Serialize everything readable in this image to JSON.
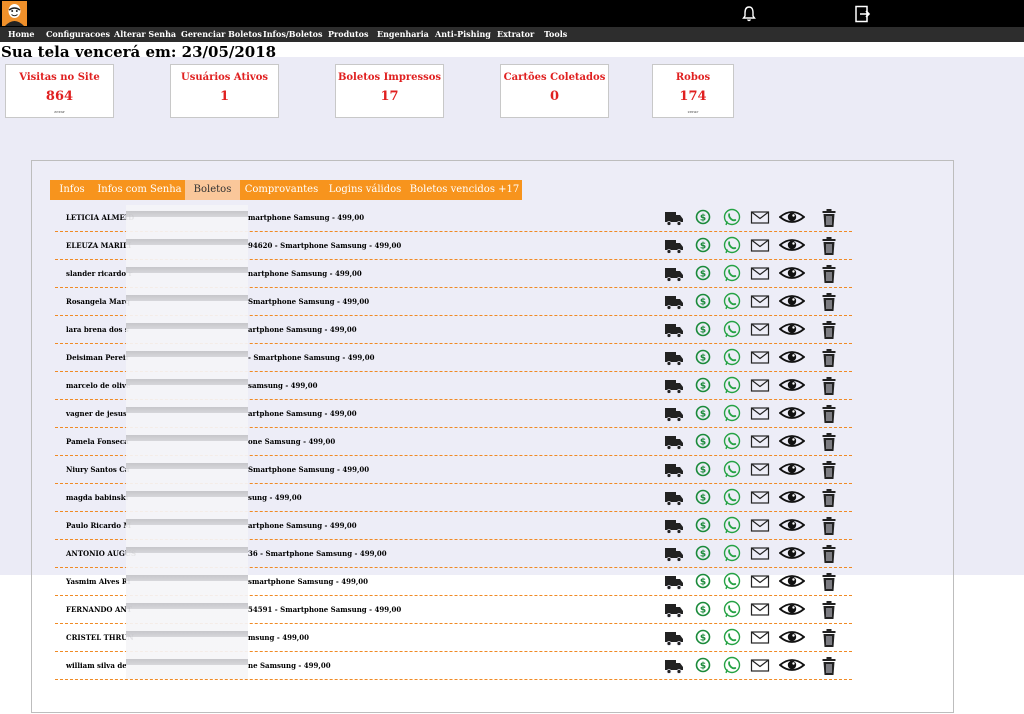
{
  "nav": {
    "items": [
      {
        "label": "Home"
      },
      {
        "label": "Configuracoes"
      },
      {
        "label": "Alterar Senha"
      },
      {
        "label": "Gerenciar Boletos"
      },
      {
        "label": "Infos/Boletos"
      },
      {
        "label": "Produtos"
      },
      {
        "label": "Engenharia"
      },
      {
        "label": "Anti-Pishing"
      },
      {
        "label": "Extrator"
      },
      {
        "label": "Tools"
      }
    ]
  },
  "header": {
    "expiry_text": "Sua tela vencerá em: 23/05/2018"
  },
  "stats": [
    {
      "label": "Visitas no Site",
      "value": "864",
      "small": "zerar"
    },
    {
      "label": "Usuários Ativos",
      "value": "1",
      "small": ""
    },
    {
      "label": "Boletos Impressos",
      "value": "17",
      "small": ""
    },
    {
      "label": "Cartões Coletados",
      "value": "0",
      "small": ""
    },
    {
      "label": "Robos",
      "value": "174",
      "small": "zerar"
    }
  ],
  "tabs": [
    {
      "label": "Infos",
      "active": false
    },
    {
      "label": "Infos com Senha",
      "active": false
    },
    {
      "label": "Boletos",
      "active": true
    },
    {
      "label": "Comprovantes",
      "active": false
    },
    {
      "label": "Logins válidos",
      "active": false
    },
    {
      "label": "Boletos vencidos +17",
      "active": false
    }
  ],
  "rows": [
    {
      "name": "LETICIA ALMEID",
      "product": "martphone Samsung - 499,00"
    },
    {
      "name": "ELEUZA MARILI",
      "product": "94620 - Smartphone Samsung - 499,00"
    },
    {
      "name": "slander ricardo r",
      "product": "nartphone Samsung - 499,00"
    },
    {
      "name": "Rosangela Marq",
      "product": "Smartphone Samsung - 499,00"
    },
    {
      "name": "lara brena dos s",
      "product": "artphone Samsung - 499,00"
    },
    {
      "name": "Deisiman Pereir",
      "product": "- Smartphone Samsung - 499,00"
    },
    {
      "name": "marcelo de olive",
      "product": "samsung - 499,00"
    },
    {
      "name": "vagner de jesus",
      "product": "artphone Samsung - 499,00"
    },
    {
      "name": "Pamela Fonseca",
      "product": "one Samsung - 499,00"
    },
    {
      "name": "Niury Santos Ca",
      "product": "Smartphone Samsung - 499,00"
    },
    {
      "name": "magda babinski",
      "product": "sung - 499,00"
    },
    {
      "name": "Paulo Ricardo M",
      "product": "artphone Samsung - 499,00"
    },
    {
      "name": "ANTONIO AUGUS",
      "product": "36 - Smartphone Samsung - 499,00"
    },
    {
      "name": "Yasmim Alves Ri",
      "product": "smartphone Samsung - 499,00"
    },
    {
      "name": "FERNANDO ANT",
      "product": "54591 - Smartphone Samsung - 499,00"
    },
    {
      "name": "CRISTEL THRUN",
      "product": "msung - 499,00"
    },
    {
      "name": "william silva de",
      "product": "ne Samsung - 499,00"
    }
  ],
  "row_icons": [
    "truck-icon",
    "dollar-icon",
    "whatsapp-icon",
    "envelope-icon",
    "eye-icon",
    "trash-icon"
  ],
  "colors": {
    "accent": "#f7941d",
    "stat_text": "#e02020",
    "whatsapp": "#25a244",
    "dollar": "#1a8a3a"
  }
}
